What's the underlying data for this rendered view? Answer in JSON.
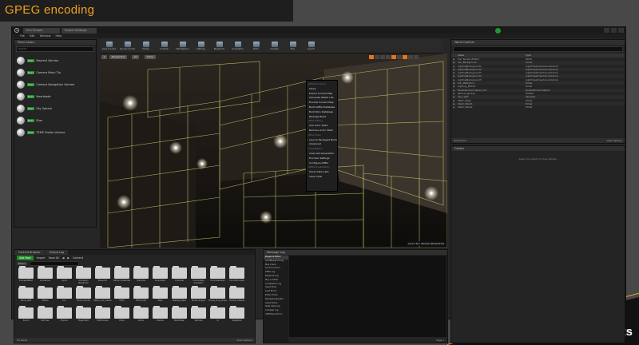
{
  "slide": {
    "title": "GPEG encoding",
    "brand": "concurrents"
  },
  "window": {
    "logo": "U",
    "tabs": [
      "Sun Temple",
      "Project Settings"
    ],
    "menu": [
      "File",
      "Edit",
      "Window",
      "Help"
    ]
  },
  "modes": {
    "tab": "Place Actors",
    "search_placeholder": "Search",
    "items": [
      {
        "tag": "Basic",
        "label": "Nearest Volume"
      },
      {
        "tag": "Basic",
        "label": "Camera Mesh Tip"
      },
      {
        "tag": "Basic",
        "label": "Camera Navigation Volume"
      },
      {
        "tag": "Basic",
        "label": "Nearblade"
      },
      {
        "tag": "Basic",
        "label": "Sky Sphere"
      },
      {
        "tag": "Basic",
        "label": "Blue"
      },
      {
        "tag": "Basic",
        "label": "TEMP Visible Volume"
      }
    ]
  },
  "toolbar": [
    "Save Current",
    "Source Control",
    "Modes",
    "Content",
    "Marketplace",
    "Settings",
    "Blueprints",
    "Cinematics",
    "Build",
    "Compile",
    "Play",
    "Launch"
  ],
  "viewport": {
    "perspective": "Perspective",
    "lit": "Lit",
    "show": "Show",
    "level_label": "Level: Sun Temple (Persistent)"
  },
  "dropdown": {
    "items": [
      {
        "type": "head",
        "text": "GPEG Encoding"
      },
      {
        "type": "item",
        "text": "Clean"
      },
      {
        "type": "item",
        "text": "Export Current Map"
      },
      {
        "type": "item",
        "text": "Generate Watch List"
      },
      {
        "type": "item",
        "text": "Encode Current Map"
      },
      {
        "type": "item",
        "text": "Build GPEG Database"
      },
      {
        "type": "item",
        "text": "Build Skin Database"
      },
      {
        "type": "item",
        "text": "Package Build"
      },
      {
        "type": "head",
        "text": "GPEG Debug"
      },
      {
        "type": "item",
        "text": "Add Actor Stats"
      },
      {
        "type": "item",
        "text": "Remove Actor Stats"
      },
      {
        "type": "head",
        "text": "Other Tools"
      },
      {
        "type": "item",
        "text": "Launch Packaged Build"
      },
      {
        "type": "item",
        "text": "Advanced"
      },
      {
        "type": "head",
        "text": "Visualization"
      },
      {
        "type": "item",
        "text": "View Cell Generation"
      },
      {
        "type": "item",
        "text": "Encoder Settings"
      },
      {
        "type": "item",
        "text": "Configure GPEG"
      },
      {
        "type": "head",
        "text": "GPEG Visualization"
      },
      {
        "type": "item",
        "text": "Show Vista Cells"
      },
      {
        "type": "item",
        "text": "Clear Cells"
      }
    ]
  },
  "outliner": {
    "tab": "World Outliner",
    "col_label": "Label",
    "col_type": "Type",
    "rows": [
      {
        "name": "Sun Temple (Editor)",
        "type": "World"
      },
      {
        "name": "Sun_Background",
        "type": "Folder"
      },
      {
        "name": "LightingBackground1",
        "type": "LightmassImportanceVolume"
      },
      {
        "name": "LightingBackground2",
        "type": "LightmassImportanceVolume"
      },
      {
        "name": "LightingBackground3",
        "type": "LightmassImportanceVolume"
      },
      {
        "name": "LightingBackground4",
        "type": "LightmassImportanceVolume"
      },
      {
        "name": "LightingBackground5",
        "type": "LightmassImportanceVolume"
      },
      {
        "name": "Sun_Reflection",
        "type": "Folder"
      },
      {
        "name": "Lighting_Effects",
        "type": "Folder"
      },
      {
        "name": "BoxReflectionCapture_Sun",
        "type": "BoxReflectionCapture"
      },
      {
        "name": "Particle_Ignition",
        "type": "Emitter"
      },
      {
        "name": "Sky_Light",
        "type": "SkyLight"
      },
      {
        "name": "Static_Mesh",
        "type": "Folder"
      },
      {
        "name": "Static_Mesh1",
        "type": "Folder"
      },
      {
        "name": "Static_Mesh2",
        "type": "Folder"
      }
    ],
    "footer_count": "576 actors",
    "footer_options": "View Options"
  },
  "details": {
    "tab": "Details",
    "hint": "Select an object to view details."
  },
  "content_browser": {
    "tabs": [
      "Content Browser",
      "Output Log"
    ],
    "add_new": "Add New",
    "import": "Import",
    "save_all": "Save All",
    "path": "Content",
    "filters": "Filters",
    "folders": [
      "AnimatedMesh",
      "Animations",
      "Audio",
      "Animation Blueprints",
      "Blueprint",
      "Cartoon Materials",
      "Character",
      "Cinematics",
      "Controller",
      "Controllable Animation",
      "ControllerMesh",
      "ControlPrompts",
      "Decal_stuff",
      "Effects",
      "Env",
      "Environments",
      "Fabric_and_Cables",
      "FBXS",
      "FBXS_UGB",
      "Maps",
      "MatHigh_Base",
      "Modes_Engine",
      "Modes_Gray_Props",
      "Modular_Meshes",
      "Sound",
      "Particles",
      "Physics",
      "PlayerStart",
      "PostProcess",
      "Props",
      "Rocks",
      "Shaders",
      "StaticMesh",
      "Textures",
      "UI",
      "Vegetation"
    ],
    "footer_count": "43 items",
    "footer_options": "View Options"
  },
  "message_log": {
    "tab": "Message Log",
    "items": [
      "Blueprint Editor",
      "AnimBlueprint Log",
      "Map Check",
      "Source Control",
      "GPEG Log",
      "Blueprint Log",
      "Play In Editor",
      "Localization Log",
      "Asset Tools",
      "Load Errors",
      "Editor Errors",
      "Packaging Results",
      "Asset Check",
      "Slate Style Log",
      "Compiler Log",
      "UDN Parse Errors"
    ],
    "selected": 0,
    "footer": "Page 1"
  }
}
